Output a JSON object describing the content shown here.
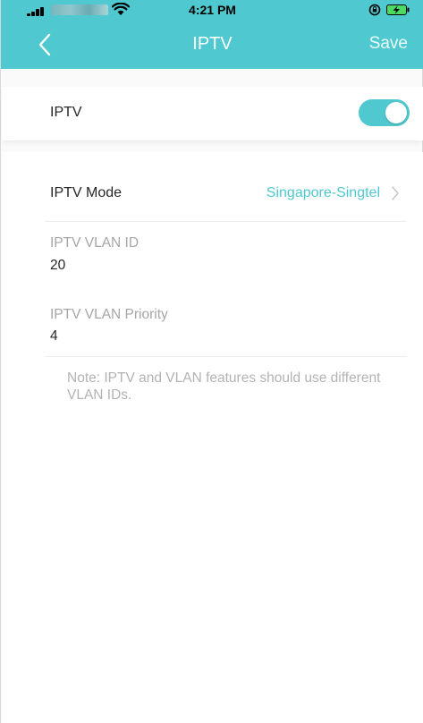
{
  "status_bar": {
    "time": "4:21 PM",
    "icons": [
      "signal-icon",
      "wifi-icon",
      "rotation-lock-icon",
      "battery-charging-icon"
    ]
  },
  "navbar": {
    "back_icon": "chevron-left-icon",
    "title": "IPTV",
    "save_label": "Save"
  },
  "iptv_toggle": {
    "label": "IPTV",
    "enabled": true
  },
  "settings": {
    "mode": {
      "label": "IPTV Mode",
      "value": "Singapore-Singtel",
      "icon": "chevron-right-icon"
    },
    "vlan_id": {
      "label": "IPTV VLAN ID",
      "value": "20"
    },
    "vlan_priority": {
      "label": "IPTV VLAN Priority",
      "value": "4"
    },
    "note": "Note: IPTV and VLAN features should use different VLAN IDs."
  },
  "colors": {
    "accent": "#4fc8cf",
    "text": "#262626",
    "muted": "#a6a6a6"
  }
}
